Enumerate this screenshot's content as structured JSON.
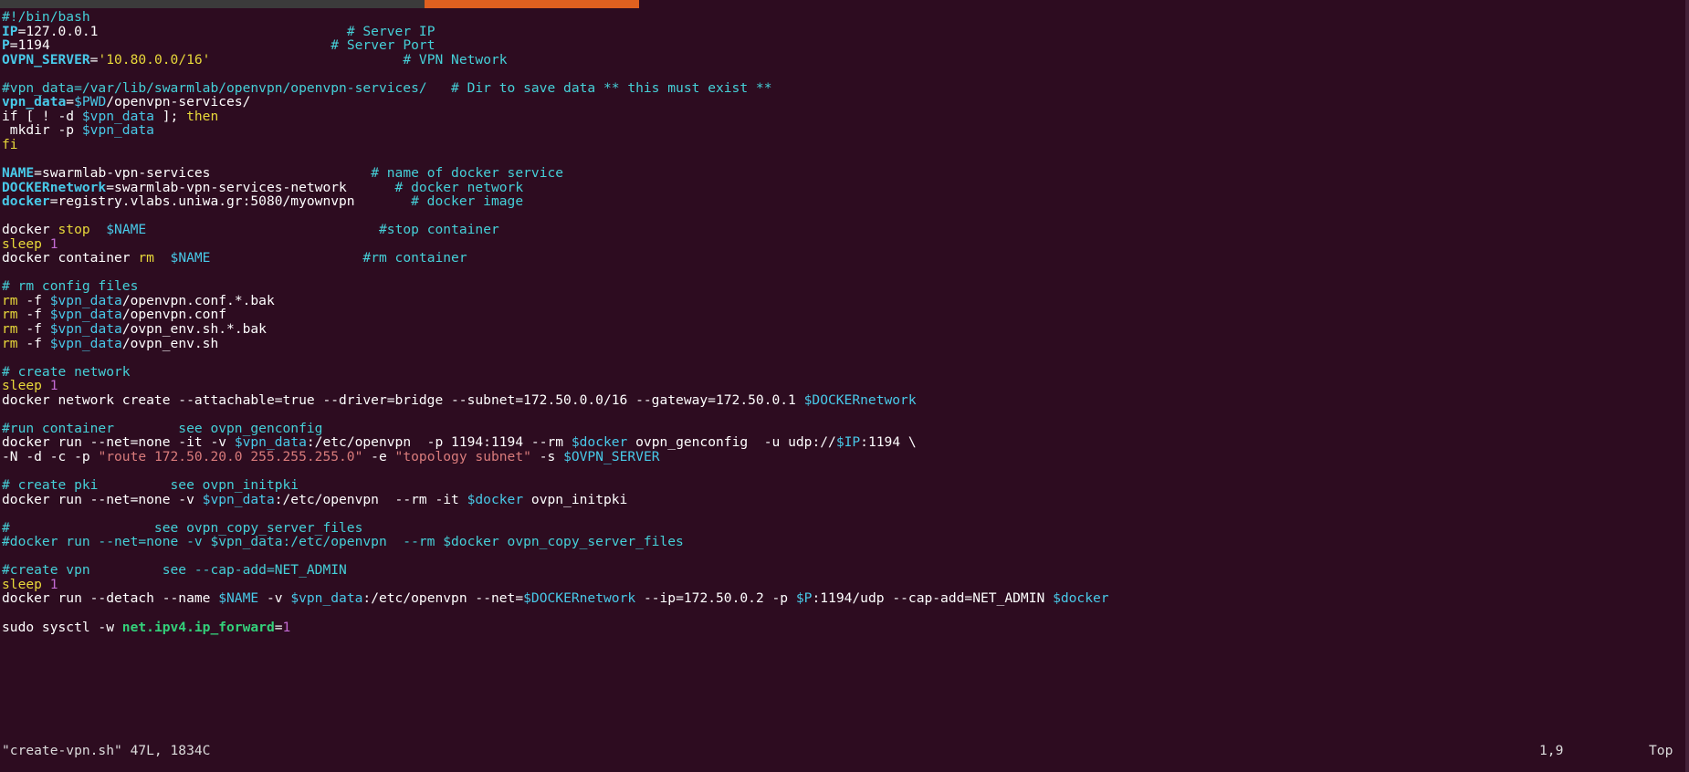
{
  "window": {
    "type": "terminal-vim-editor",
    "background_color": "#2d0c20",
    "accent_color": "#e0601f"
  },
  "topbar": {
    "dark_segment_color": "#3b3b3b",
    "orange_segment_color": "#e0601f"
  },
  "palette": {
    "plain": "#ffffff",
    "comment": "#45d0d8",
    "variable": "#48c9e8",
    "builtin": "#e8d93a",
    "string_double": "#d97b7b",
    "number": "#c36bd4",
    "option": "#d97b7b",
    "green_ident": "#33d17a"
  },
  "statusline": {
    "file": "\"create-vpn.sh\" 47L, 1834C",
    "position": "1,9",
    "scroll": "Top"
  },
  "code": {
    "lines": [
      [
        {
          "t": "comment",
          "s": "#!/bin/bash"
        }
      ],
      [
        {
          "t": "var",
          "s": "IP"
        },
        {
          "t": "plain",
          "s": "=127.0.0.1"
        },
        {
          "t": "plain",
          "s": "                               "
        },
        {
          "t": "comment",
          "s": "# Server IP"
        }
      ],
      [
        {
          "t": "var",
          "s": "P"
        },
        {
          "t": "plain",
          "s": "=1194"
        },
        {
          "t": "plain",
          "s": "                                   "
        },
        {
          "t": "comment",
          "s": "# Server Port"
        }
      ],
      [
        {
          "t": "var",
          "s": "OVPN_SERVER"
        },
        {
          "t": "plain",
          "s": "="
        },
        {
          "t": "string",
          "s": "'10.80.0.0/16'"
        },
        {
          "t": "plain",
          "s": "                        "
        },
        {
          "t": "comment",
          "s": "# VPN Network"
        }
      ],
      [
        {
          "t": "plain",
          "s": ""
        }
      ],
      [
        {
          "t": "comment",
          "s": "#vpn_data=/var/lib/swarmlab/openvpn/openvpn-services/"
        },
        {
          "t": "plain",
          "s": "   "
        },
        {
          "t": "comment",
          "s": "# Dir to save data ** this must exist **"
        }
      ],
      [
        {
          "t": "var",
          "s": "vpn_data"
        },
        {
          "t": "plain",
          "s": "="
        },
        {
          "t": "varuse",
          "s": "$PWD"
        },
        {
          "t": "plain",
          "s": "/openvpn-services/"
        }
      ],
      [
        {
          "t": "plain",
          "s": "if [ ! -d "
        },
        {
          "t": "varuse",
          "s": "$vpn_data"
        },
        {
          "t": "plain",
          "s": " ]; "
        },
        {
          "t": "builtin",
          "s": "then"
        }
      ],
      [
        {
          "t": "plain",
          "s": " mkdir -p "
        },
        {
          "t": "varuse",
          "s": "$vpn_data"
        }
      ],
      [
        {
          "t": "builtin",
          "s": "fi"
        }
      ],
      [
        {
          "t": "plain",
          "s": ""
        }
      ],
      [
        {
          "t": "var",
          "s": "NAME"
        },
        {
          "t": "plain",
          "s": "=swarmlab-vpn-services"
        },
        {
          "t": "plain",
          "s": "                    "
        },
        {
          "t": "comment",
          "s": "# name of docker service"
        }
      ],
      [
        {
          "t": "var",
          "s": "DOCKERnetwork"
        },
        {
          "t": "plain",
          "s": "=swarmlab-vpn-services-network"
        },
        {
          "t": "plain",
          "s": "      "
        },
        {
          "t": "comment",
          "s": "# docker network"
        }
      ],
      [
        {
          "t": "var",
          "s": "docker"
        },
        {
          "t": "plain",
          "s": "=registry.vlabs.uniwa.gr:5080/myownvpn"
        },
        {
          "t": "plain",
          "s": "       "
        },
        {
          "t": "comment",
          "s": "# docker image"
        }
      ],
      [
        {
          "t": "plain",
          "s": ""
        }
      ],
      [
        {
          "t": "plain",
          "s": "docker "
        },
        {
          "t": "builtin",
          "s": "stop"
        },
        {
          "t": "plain",
          "s": "  "
        },
        {
          "t": "varuse",
          "s": "$NAME"
        },
        {
          "t": "plain",
          "s": "                             "
        },
        {
          "t": "comment",
          "s": "#stop container"
        }
      ],
      [
        {
          "t": "builtin",
          "s": "sleep"
        },
        {
          "t": "plain",
          "s": " "
        },
        {
          "t": "number",
          "s": "1"
        }
      ],
      [
        {
          "t": "plain",
          "s": "docker container "
        },
        {
          "t": "builtin",
          "s": "rm"
        },
        {
          "t": "plain",
          "s": "  "
        },
        {
          "t": "varuse",
          "s": "$NAME"
        },
        {
          "t": "plain",
          "s": "                   "
        },
        {
          "t": "comment",
          "s": "#rm container"
        }
      ],
      [
        {
          "t": "plain",
          "s": ""
        }
      ],
      [
        {
          "t": "comment",
          "s": "# rm config files"
        }
      ],
      [
        {
          "t": "builtin",
          "s": "rm"
        },
        {
          "t": "plain",
          "s": " -f "
        },
        {
          "t": "varuse",
          "s": "$vpn_data"
        },
        {
          "t": "plain",
          "s": "/openvpn.conf.*.bak"
        }
      ],
      [
        {
          "t": "builtin",
          "s": "rm"
        },
        {
          "t": "plain",
          "s": " -f "
        },
        {
          "t": "varuse",
          "s": "$vpn_data"
        },
        {
          "t": "plain",
          "s": "/openvpn.conf"
        }
      ],
      [
        {
          "t": "builtin",
          "s": "rm"
        },
        {
          "t": "plain",
          "s": " -f "
        },
        {
          "t": "varuse",
          "s": "$vpn_data"
        },
        {
          "t": "plain",
          "s": "/ovpn_env.sh.*.bak"
        }
      ],
      [
        {
          "t": "builtin",
          "s": "rm"
        },
        {
          "t": "plain",
          "s": " -f "
        },
        {
          "t": "varuse",
          "s": "$vpn_data"
        },
        {
          "t": "plain",
          "s": "/ovpn_env.sh"
        }
      ],
      [
        {
          "t": "plain",
          "s": ""
        }
      ],
      [
        {
          "t": "comment",
          "s": "# create network"
        }
      ],
      [
        {
          "t": "builtin",
          "s": "sleep"
        },
        {
          "t": "plain",
          "s": " "
        },
        {
          "t": "number",
          "s": "1"
        }
      ],
      [
        {
          "t": "plain",
          "s": "docker network create --attachable=true --driver=bridge --subnet=172.50.0.0/16 --gateway=172.50.0.1 "
        },
        {
          "t": "varuse",
          "s": "$DOCKERnetwork"
        }
      ],
      [
        {
          "t": "plain",
          "s": ""
        }
      ],
      [
        {
          "t": "comment",
          "s": "#run container        see ovpn_genconfig"
        }
      ],
      [
        {
          "t": "plain",
          "s": "docker run --net=none -it -v "
        },
        {
          "t": "varuse",
          "s": "$vpn_data"
        },
        {
          "t": "plain",
          "s": ":/etc/openvpn  -p 1194:1194 --rm "
        },
        {
          "t": "varuse",
          "s": "$docker"
        },
        {
          "t": "plain",
          "s": " ovpn_genconfig  -u udp://"
        },
        {
          "t": "varuse",
          "s": "$IP"
        },
        {
          "t": "plain",
          "s": ":1194 \\"
        }
      ],
      [
        {
          "t": "plain",
          "s": "-N -d -c -p "
        },
        {
          "t": "dqstring",
          "s": "\"route 172.50.20.0 255.255.255.0\""
        },
        {
          "t": "plain",
          "s": " -e "
        },
        {
          "t": "dqstring",
          "s": "\"topology subnet\""
        },
        {
          "t": "plain",
          "s": " -s "
        },
        {
          "t": "varuse",
          "s": "$OVPN_SERVER"
        }
      ],
      [
        {
          "t": "plain",
          "s": ""
        }
      ],
      [
        {
          "t": "comment",
          "s": "# create pki         see ovpn_initpki"
        }
      ],
      [
        {
          "t": "plain",
          "s": "docker run --net=none -v "
        },
        {
          "t": "varuse",
          "s": "$vpn_data"
        },
        {
          "t": "plain",
          "s": ":/etc/openvpn  --rm -it "
        },
        {
          "t": "varuse",
          "s": "$docker"
        },
        {
          "t": "plain",
          "s": " ovpn_initpki"
        }
      ],
      [
        {
          "t": "plain",
          "s": ""
        }
      ],
      [
        {
          "t": "comment",
          "s": "#                  see ovpn_copy_server_files"
        }
      ],
      [
        {
          "t": "comment",
          "s": "#docker run --net=none -v $vpn_data:/etc/openvpn  --rm $docker ovpn_copy_server_files"
        }
      ],
      [
        {
          "t": "plain",
          "s": ""
        }
      ],
      [
        {
          "t": "comment",
          "s": "#create vpn         see --cap-add=NET_ADMIN"
        }
      ],
      [
        {
          "t": "builtin",
          "s": "sleep"
        },
        {
          "t": "plain",
          "s": " "
        },
        {
          "t": "number",
          "s": "1"
        }
      ],
      [
        {
          "t": "plain",
          "s": "docker run --detach --name "
        },
        {
          "t": "varuse",
          "s": "$NAME"
        },
        {
          "t": "plain",
          "s": " -v "
        },
        {
          "t": "varuse",
          "s": "$vpn_data"
        },
        {
          "t": "plain",
          "s": ":/etc/openvpn --net="
        },
        {
          "t": "varuse",
          "s": "$DOCKERnetwork"
        },
        {
          "t": "plain",
          "s": " --ip=172.50.0.2 -p "
        },
        {
          "t": "varuse",
          "s": "$P"
        },
        {
          "t": "plain",
          "s": ":1194/udp --cap-add=NET_ADMIN "
        },
        {
          "t": "varuse",
          "s": "$docker"
        }
      ],
      [
        {
          "t": "plain",
          "s": ""
        }
      ],
      [
        {
          "t": "plain",
          "s": "sudo sysctl -w "
        },
        {
          "t": "greenvar",
          "s": "net.ipv4.ip_forward"
        },
        {
          "t": "plain",
          "s": "="
        },
        {
          "t": "number",
          "s": "1"
        }
      ]
    ]
  }
}
